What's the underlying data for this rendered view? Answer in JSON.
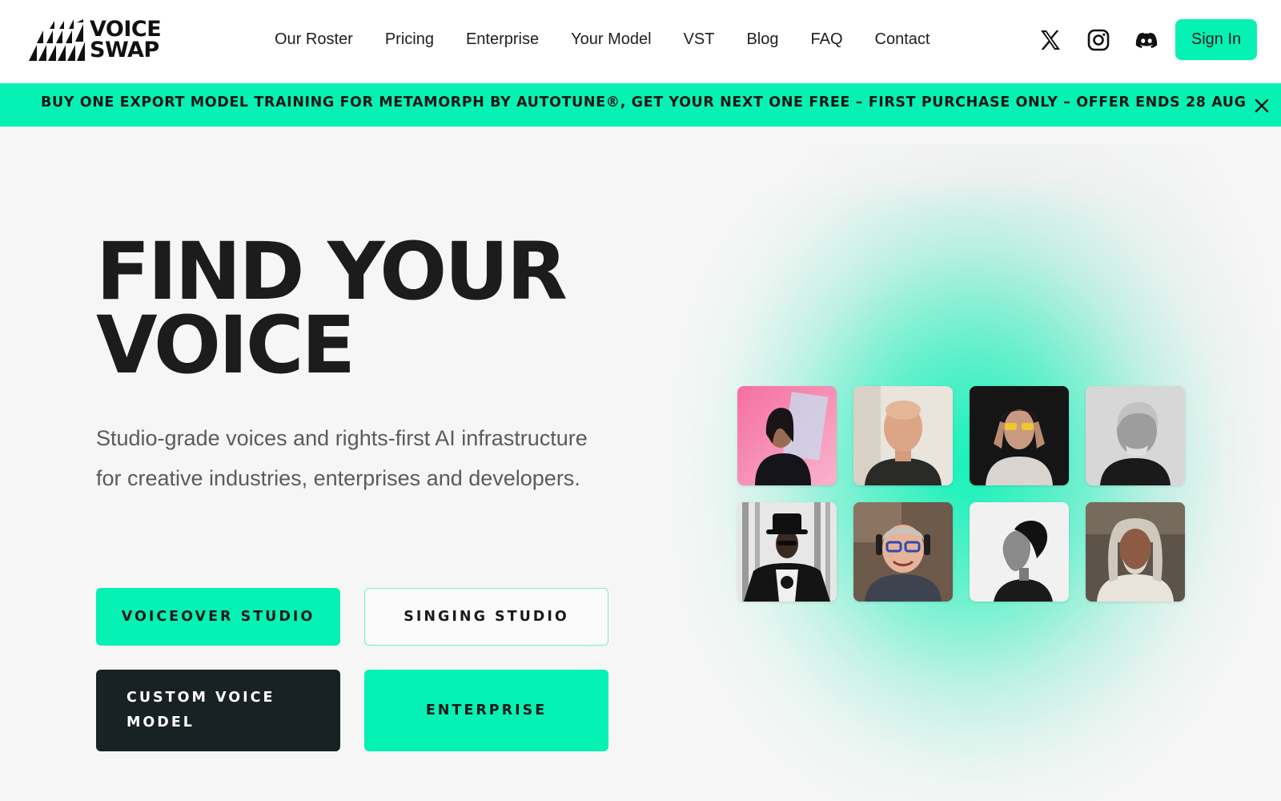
{
  "brand": {
    "line1": "VOICE",
    "line2": "SWAP",
    "accent": "#05f2b4",
    "dark": "#182123"
  },
  "nav": [
    {
      "label": "Our Roster"
    },
    {
      "label": "Pricing"
    },
    {
      "label": "Enterprise"
    },
    {
      "label": "Your Model"
    },
    {
      "label": "VST"
    },
    {
      "label": "Blog"
    },
    {
      "label": "FAQ"
    },
    {
      "label": "Contact"
    }
  ],
  "social": {
    "icons": [
      "x-icon",
      "instagram-icon",
      "discord-icon"
    ]
  },
  "header": {
    "signin_label": "Sign In"
  },
  "banner": {
    "text": "BUY ONE EXPORT MODEL TRAINING FOR METAMORPH BY AUTOTUNE®, GET YOUR NEXT ONE FREE – FIRST PURCHASE ONLY – OFFER ENDS 28 AUG",
    "close_icon": "close-icon"
  },
  "hero": {
    "title_line1": "FIND YOUR",
    "title_line2": "VOICE",
    "subtitle": "Studio-grade voices and rights-first AI infrastructure for creative industries, enterprises and developers."
  },
  "buttons": {
    "voiceover": "VOICEOVER STUDIO",
    "singing": "SINGING STUDIO",
    "custom": "CUSTOM VOICE MODEL",
    "enterprise": "ENTERPRISE"
  },
  "portraits": [
    "artist-portrait-1",
    "artist-portrait-2",
    "artist-portrait-3",
    "artist-portrait-4",
    "artist-portrait-5",
    "artist-portrait-6",
    "artist-portrait-7",
    "artist-portrait-8"
  ]
}
